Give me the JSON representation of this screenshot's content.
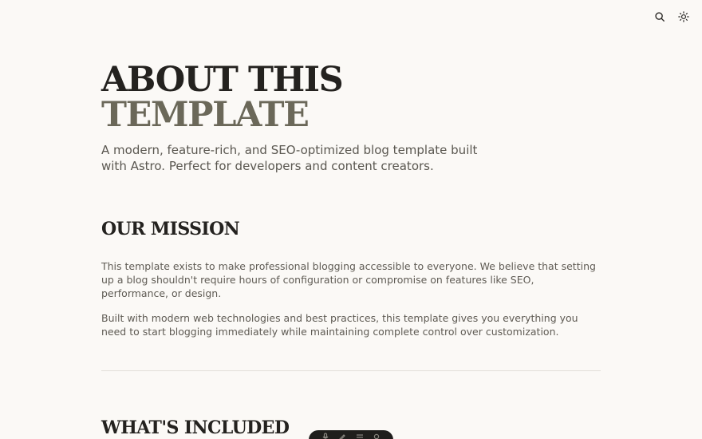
{
  "header": {
    "search_icon": "search-icon",
    "theme_icon": "sun-icon"
  },
  "hero": {
    "title_line1": "About this",
    "title_line2": "template",
    "subtitle": "A modern, feature-rich, and SEO-optimized blog template built with Astro. Perfect for developers and content creators."
  },
  "mission": {
    "title": "Our Mission",
    "paragraphs": [
      "This template exists to make professional blogging accessible to everyone. We believe that setting up a blog shouldn't require hours of configuration or compromise on features like SEO, performance, or design.",
      "Built with modern web technologies and best practices, this template gives you everything you need to start blogging immediately while maintaining complete control over customization."
    ]
  },
  "included": {
    "title": "What's Included"
  },
  "dock": {
    "items": [
      "microphone-icon",
      "pencil-icon",
      "menu-icon",
      "settings-icon"
    ]
  },
  "colors": {
    "background": "#fbf9f6",
    "title_dark": "#24221f",
    "title_muted": "#6b6859",
    "body_text": "#5f5b54",
    "dock_bg": "#1f1e1c"
  }
}
